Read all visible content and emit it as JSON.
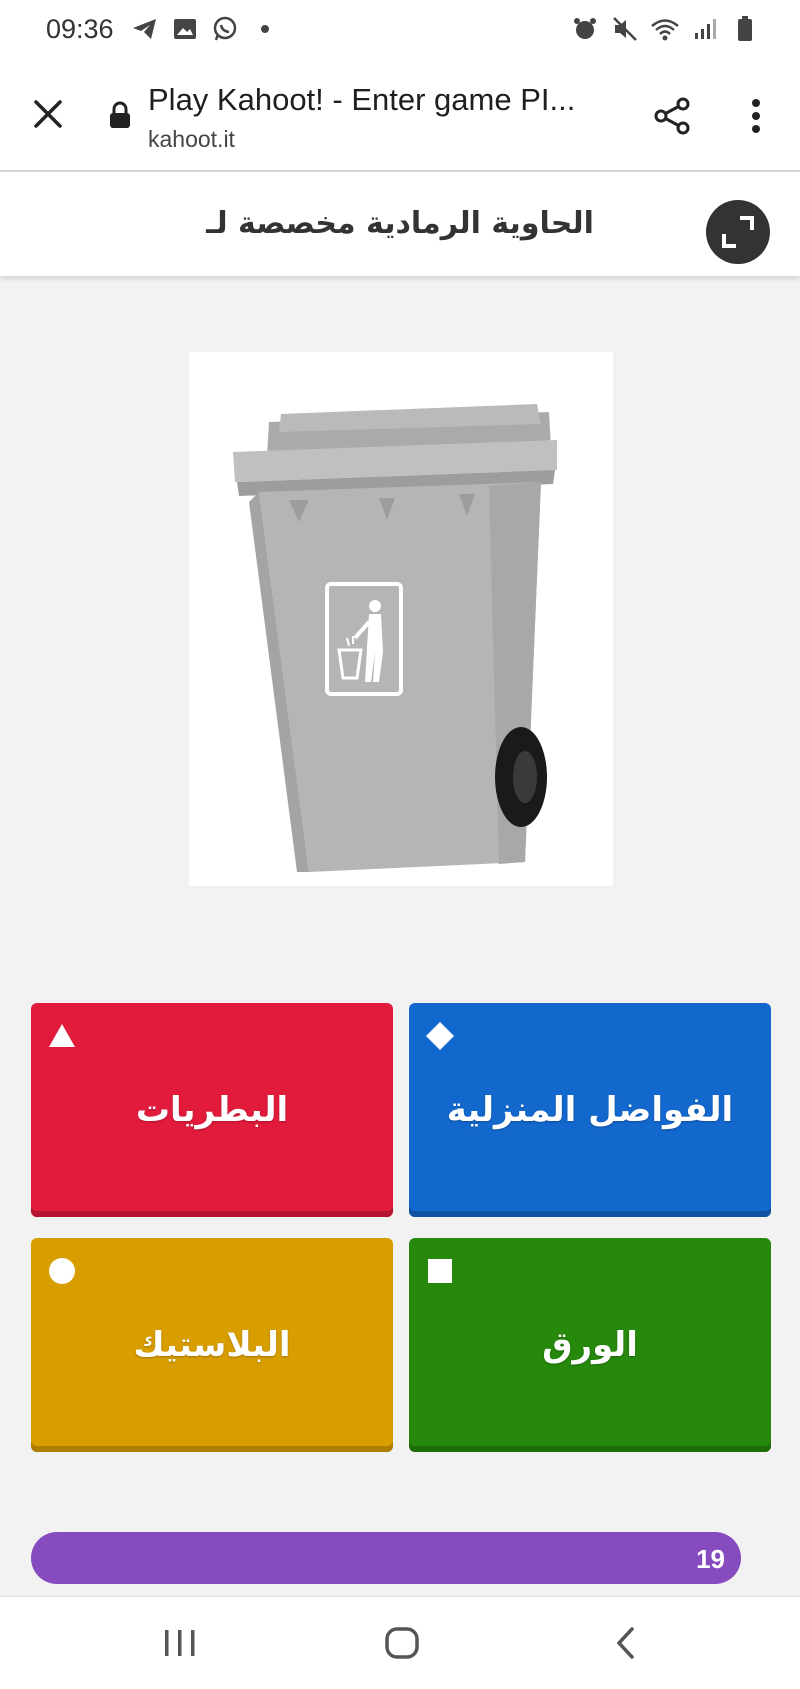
{
  "status_bar": {
    "time": "09:36",
    "left_icons": [
      "telegram-icon",
      "gallery-icon",
      "whatsapp-icon",
      "dot-icon"
    ],
    "right_icons": [
      "alarm-icon",
      "mute-icon",
      "wifi-icon",
      "signal-icon",
      "battery-icon"
    ]
  },
  "browser": {
    "title": "Play Kahoot! - Enter game PI...",
    "url": "kahoot.it"
  },
  "question": {
    "text": "الحاوية الرمادية مخصصة لـ"
  },
  "image": {
    "subject": "grey-wheelie-bin"
  },
  "answers": [
    {
      "label": "البطريات",
      "color": "#e21b3c",
      "shape": "triangle-icon"
    },
    {
      "label": "الفواضل المنزلية",
      "color": "#1368ce",
      "shape": "diamond-icon"
    },
    {
      "label": "البلاستيك",
      "color": "#d89e00",
      "shape": "circle-icon"
    },
    {
      "label": "الورق",
      "color": "#26890c",
      "shape": "square-icon"
    }
  ],
  "timer": {
    "count": "19",
    "color": "#864cbf"
  },
  "nav": [
    "recent-apps-icon",
    "home-icon",
    "back-icon"
  ]
}
